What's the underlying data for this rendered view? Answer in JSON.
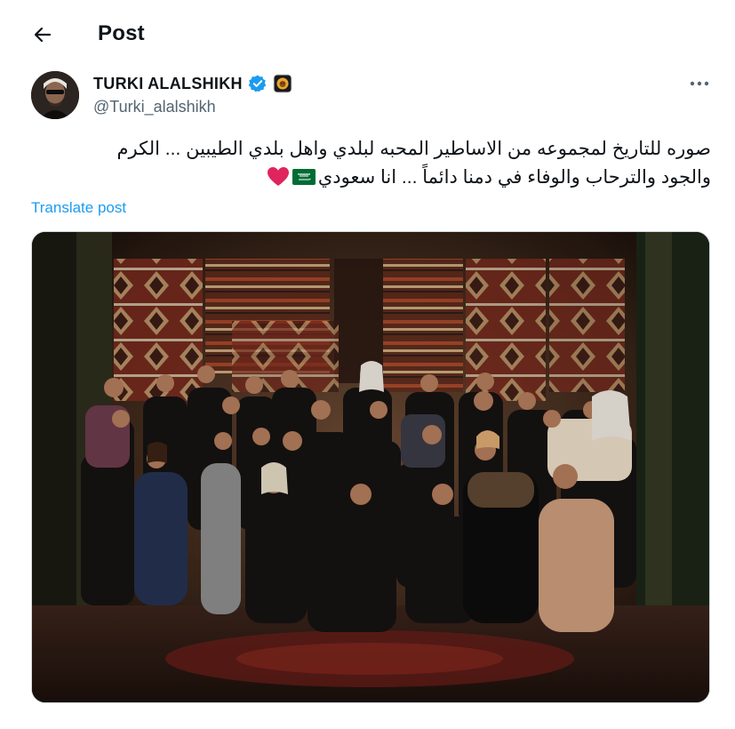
{
  "header": {
    "title": "Post",
    "back_icon": "arrow-left-icon"
  },
  "author": {
    "display_name": "TURKI ALALSHIKH",
    "handle": "@Turki_alalshikh",
    "verified_icon": "verified-badge-icon",
    "affiliation_icon": "lion-badge-icon",
    "more_icon": "more-horizontal-icon"
  },
  "post": {
    "text_line1": "صوره للتاريخ لمجموعه من الاساطير المحبه لبلدي واهل بلدي الطيبين ... الكرم",
    "text_line2": "والجود والترحاب والوفاء في دمنا دائماً ... انا سعودي",
    "emoji_flag": "saudi-flag-icon",
    "emoji_heart": "red-heart-icon",
    "translate_label": "Translate post"
  },
  "media": {
    "type": "photo",
    "icon": "group-photo-image"
  },
  "colors": {
    "link": "#1d9bf0",
    "muted": "#536471",
    "verified": "#1d9bf0",
    "heart": "#e0245e"
  }
}
